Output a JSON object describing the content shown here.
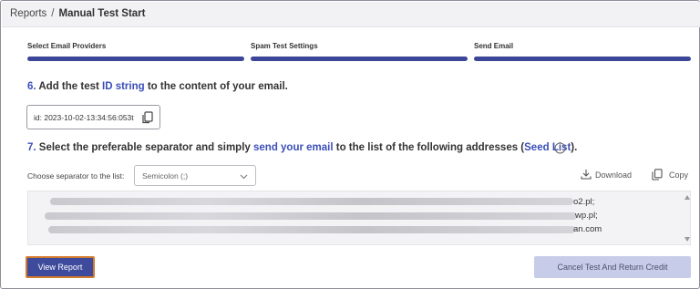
{
  "breadcrumb": {
    "root": "Reports",
    "separator": "/",
    "current": "Manual Test Start"
  },
  "steps": [
    {
      "label": "Select Email Providers"
    },
    {
      "label": "Spam Test Settings"
    },
    {
      "label": "Send Email"
    }
  ],
  "step6": {
    "number": "6.",
    "text_before": "Add the test ",
    "highlight": "ID string",
    "text_after": " to the content of your email."
  },
  "id_field": {
    "value": "id: 2023-10-02-13:34:56:053t",
    "icon": "copy-icon"
  },
  "step7": {
    "number": "7.",
    "text_before": "Select the preferable separator and simply ",
    "highlight1": "send your email",
    "text_middle": " to the list of the following addresses (",
    "highlight2": "Seed List",
    "text_after": ").",
    "icon": "info-icon"
  },
  "separator": {
    "label": "Choose separator to the list:",
    "selected": "Semicolon (;)"
  },
  "tools": {
    "download": "Download",
    "copy": "Copy"
  },
  "seed_list": {
    "line_endings": [
      "o2.pl;",
      "wp.pl;",
      "an.com"
    ]
  },
  "buttons": {
    "view_report": "View Report",
    "cancel": "Cancel Test And Return Credit"
  },
  "colors": {
    "accent": "#3b4fb8",
    "progress": "#3c4698",
    "button_primary": "#3e4a9c",
    "button_disabled": "#c7cce8",
    "focus_outline": "#d27a2e"
  }
}
